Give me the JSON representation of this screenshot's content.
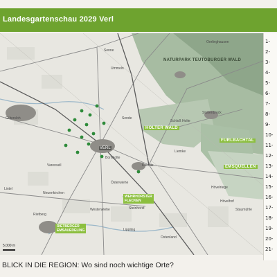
{
  "header": {
    "title": "Landesgartenschau 2029 Verl"
  },
  "map": {
    "places": {
      "verl": "VERL",
      "guetersloh": "Gütersloh",
      "varensell": "Varensell",
      "neuenkirchen": "Neuenkirchen",
      "lintel": "Lintel",
      "rietberg": "Rietberg",
      "westerwiehe": "Westerwiehe",
      "steinhorst": "Steinhorst",
      "lippling": "Lippling",
      "ostenland": "Ostenland",
      "kaunitz": "Kaunitz",
      "oesterwiehe": "Österwiehe",
      "bornholte": "Bornholte",
      "sende": "Sende",
      "liemke": "Liemke",
      "stukenbrock": "Stukenbrock",
      "hoevelriege": "Hövelriege",
      "hoevelhof": "Hövelhof",
      "staumuehle": "Staumühle",
      "senne": "Senne",
      "oerlinghausen": "Oerlinghausen",
      "schlossholte": "Schloß Holte",
      "ummeln": "Ummeln"
    },
    "regions": {
      "teutoburger": "NATURPARK TEUTOBURGER WALD",
      "holter": "HOLTER WALD",
      "furlbach": "FURLBACHTAL",
      "emsquellen": "EMSQUELLEN"
    },
    "tags": {
      "wehrhorster": "WEHRHORSTER\nFLECKEN",
      "rietberger": "RIETBERGER\nEMSAUEDELING"
    },
    "scale": "5.000 m"
  },
  "notes": [
    "1-",
    "2-",
    "3-",
    "4-",
    "5-",
    "6-",
    "7-",
    "8-",
    "9-",
    "10-",
    "11-",
    "12-",
    "13-",
    "14-",
    "15-",
    "16-",
    "17-",
    "18-",
    "19-",
    "20-",
    "21-"
  ],
  "footer": {
    "question": "BLICK IN DIE REGION: Wo sind noch wichtige Orte?"
  },
  "colors": {
    "header": "#6ea32f",
    "forest": "#9fb79a",
    "forest_dark": "#7f9b7d",
    "tag": "#8cbf3f",
    "marker": "#2e8b3a"
  }
}
